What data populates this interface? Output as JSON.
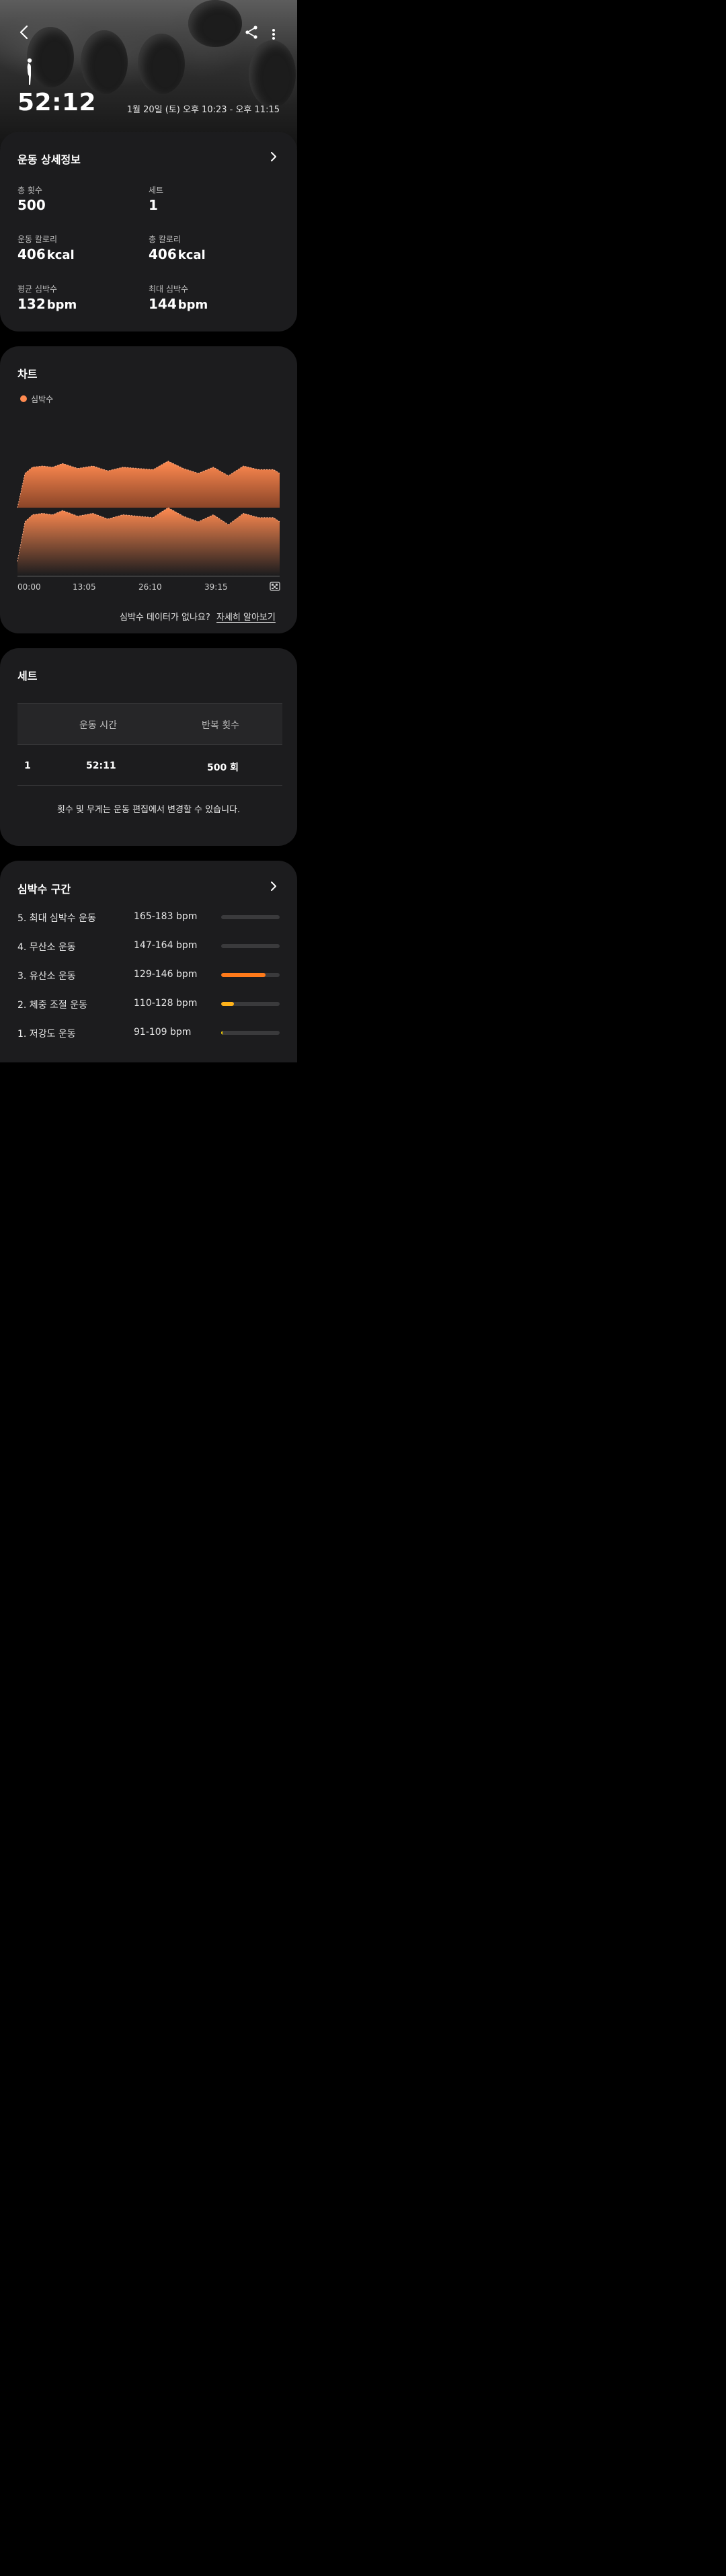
{
  "header": {
    "duration": "52:12",
    "datetime": "1월 20일 (토) 오후 10:23 - 오후 11:15"
  },
  "details": {
    "title": "운동 상세정보",
    "stats": [
      {
        "label": "총 횟수",
        "value": "500",
        "unit": ""
      },
      {
        "label": "세트",
        "value": "1",
        "unit": ""
      },
      {
        "label": "운동 칼로리",
        "value": "406",
        "unit": "kcal"
      },
      {
        "label": "총 칼로리",
        "value": "406",
        "unit": "kcal"
      },
      {
        "label": "평균 심박수",
        "value": "132",
        "unit": "bpm"
      },
      {
        "label": "최대 심박수",
        "value": "144",
        "unit": "bpm"
      }
    ]
  },
  "chart_section": {
    "title": "차트",
    "legend": "심박수",
    "help_question": "심박수 데이터가 없나요?",
    "help_link": "자세히 알아보기"
  },
  "chart_data": {
    "type": "area",
    "title": "",
    "xlabel": "",
    "ylabel": "",
    "x_ticks": [
      "00:00",
      "13:05",
      "26:10",
      "39:15"
    ],
    "x": [
      0,
      1.5,
      3,
      5,
      7,
      9,
      12,
      15,
      18,
      21,
      24,
      27,
      30,
      33,
      36,
      39,
      42,
      45,
      48,
      51,
      52.2
    ],
    "series": [
      {
        "name": "심박수",
        "color": "#ff8a50",
        "values": [
          100,
          128,
          133,
          134,
          133,
          136,
          132,
          134,
          130,
          133,
          132,
          131,
          138,
          132,
          128,
          133,
          126,
          134,
          131,
          131,
          128
        ]
      }
    ],
    "grid": false
  },
  "sets": {
    "title": "세트",
    "headers": [
      "운동 시간",
      "반복 횟수"
    ],
    "rows": [
      {
        "index": "1",
        "time": "52:11",
        "reps": "500 회"
      }
    ],
    "note": "횟수 및 무게는 운동 편집에서 변경할 수 있습니다."
  },
  "zones": {
    "title": "심박수 구간",
    "items": [
      {
        "name": "5. 최대 심박수 운동",
        "range": "165-183 bpm",
        "fraction": 0,
        "color": "#ff7a1a"
      },
      {
        "name": "4. 무산소 운동",
        "range": "147-164 bpm",
        "fraction": 0,
        "color": "#ff7a1a"
      },
      {
        "name": "3. 유산소 운동",
        "range": "129-146 bpm",
        "fraction": 0.76,
        "color": "#ff7a1a"
      },
      {
        "name": "2. 체중 조절 운동",
        "range": "110-128 bpm",
        "fraction": 0.22,
        "color": "#ffb21a"
      },
      {
        "name": "1. 저강도 운동",
        "range": "91-109 bpm",
        "fraction": 0.02,
        "color": "#f5d000"
      }
    ]
  }
}
